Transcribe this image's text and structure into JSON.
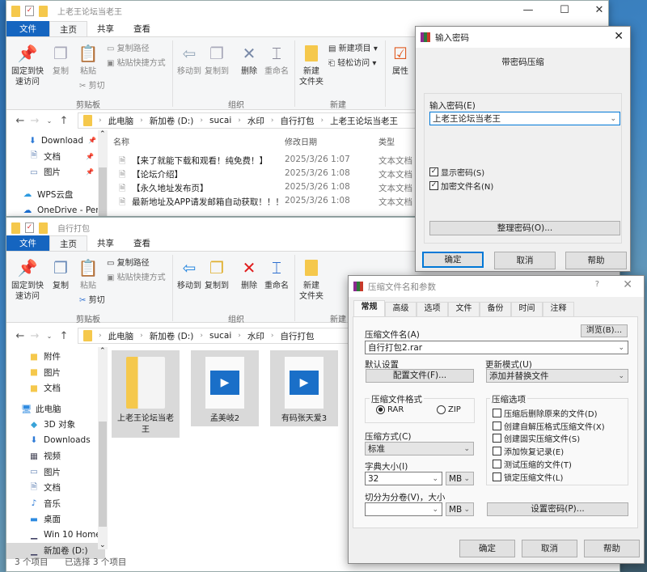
{
  "colors": {
    "accent": "#1565c0",
    "delete_red": "#e01c1c",
    "selection": "#d9d9d9"
  },
  "explorer1": {
    "title": "上老王论坛当老王",
    "window_controls": [
      "—",
      "☐",
      "✕"
    ],
    "tabs": [
      "文件",
      "主页",
      "共享",
      "查看"
    ],
    "ribbon": {
      "pin": "固定到快\n速访问",
      "copy": "复制",
      "paste": "粘贴",
      "copy_path": "复制路径",
      "paste_shortcut": "粘贴快捷方式",
      "cut": "剪切",
      "clipboard": "剪贴板",
      "move_to": "移动到",
      "copy_to": "复制到",
      "delete": "删除",
      "rename": "重命名",
      "organize": "组织",
      "new_folder": "新建\n文件夹",
      "new_item": "新建项目 ▾",
      "easy_access": "轻松访问 ▾",
      "new": "新建",
      "properties": "属性"
    },
    "breadcrumb": [
      "此电脑",
      "新加卷 (D:)",
      "sucai",
      "水印",
      "自行打包",
      "上老王论坛当老王"
    ],
    "sidebar": [
      {
        "label": "Download",
        "icon": "download-icon"
      },
      {
        "label": "文档",
        "icon": "document-icon"
      },
      {
        "label": "图片",
        "icon": "picture-icon"
      },
      {
        "label": "WPS云盘",
        "icon": "cloud-icon"
      },
      {
        "label": "OneDrive - Per",
        "icon": "onedrive-icon"
      }
    ],
    "columns": [
      "名称",
      "修改日期",
      "类型"
    ],
    "files": [
      {
        "name": "【来了就能下载和观看！纯免费！】",
        "date": "2025/3/26 1:07",
        "type": "文本文档"
      },
      {
        "name": "【论坛介绍】",
        "date": "2025/3/26 1:08",
        "type": "文本文档"
      },
      {
        "name": "【永久地址发布页】",
        "date": "2025/3/26 1:08",
        "type": "文本文档"
      },
      {
        "name": "最新地址及APP请发邮箱自动获取！！！",
        "date": "2025/3/26 1:08",
        "type": "文本文档"
      }
    ]
  },
  "explorer2": {
    "title": "自行打包",
    "tabs": [
      "文件",
      "主页",
      "共享",
      "查看"
    ],
    "ribbon": {
      "pin": "固定到快\n速访问",
      "copy": "复制",
      "paste": "粘贴",
      "copy_path": "复制路径",
      "paste_shortcut": "粘贴快捷方式",
      "cut": "剪切",
      "clipboard": "剪贴板",
      "move_to": "移动到",
      "copy_to": "复制到",
      "delete": "删除",
      "rename": "重命名",
      "organize": "组织",
      "new_folder": "新建\n文件夹",
      "new": "新建"
    },
    "breadcrumb": [
      "此电脑",
      "新加卷 (D:)",
      "sucai",
      "水印",
      "自行打包"
    ],
    "sidebar": [
      {
        "label": "附件",
        "icon": "folder-icon"
      },
      {
        "label": "图片",
        "icon": "folder-icon"
      },
      {
        "label": "文档",
        "icon": "folder-icon"
      },
      {
        "label": "此电脑",
        "icon": "computer-icon"
      },
      {
        "label": "3D 对象",
        "icon": "3d-objects-icon"
      },
      {
        "label": "Downloads",
        "icon": "download-icon"
      },
      {
        "label": "视频",
        "icon": "video-icon"
      },
      {
        "label": "图片",
        "icon": "picture-icon"
      },
      {
        "label": "文档",
        "icon": "document-icon"
      },
      {
        "label": "音乐",
        "icon": "music-icon"
      },
      {
        "label": "桌面",
        "icon": "desktop-icon"
      },
      {
        "label": "Win 10 Home",
        "icon": "network-drive-icon"
      },
      {
        "label": "新加卷 (D:)",
        "icon": "drive-icon"
      }
    ],
    "items": [
      {
        "name": "上老王论坛当老王",
        "kind": "folder"
      },
      {
        "name": "孟美岐2",
        "kind": "video"
      },
      {
        "name": "有码张天爱3",
        "kind": "video"
      }
    ],
    "status_count": "3 个项目",
    "status_selected": "已选择 3 个项目"
  },
  "password_dialog": {
    "title": "输入密码",
    "heading": "带密码压缩",
    "password_label": "输入密码(E)",
    "password_value": "上老王论坛当老王",
    "show_password": {
      "label": "显示密码(S)",
      "checked": true
    },
    "encrypt_names": {
      "label": "加密文件名(N)",
      "checked": true
    },
    "organize": "整理密码(O)...",
    "ok": "确定",
    "cancel": "取消",
    "help": "帮助"
  },
  "archive_dialog": {
    "title": "压缩文件名和参数",
    "help_glyph": "?",
    "tabs": [
      "常规",
      "高级",
      "选项",
      "文件",
      "备份",
      "时间",
      "注释"
    ],
    "archive_name_label": "压缩文件名(A)",
    "browse": "浏览(B)...",
    "archive_name": "自行打包2.rar",
    "default_settings": "默认设置",
    "profiles": "配置文件(F)...",
    "update_mode_label": "更新模式(U)",
    "update_mode": "添加并替换文件",
    "format_label": "压缩文件格式",
    "format_rar": "RAR",
    "format_zip": "ZIP",
    "format_selected": "RAR",
    "method_label": "压缩方式(C)",
    "method": "标准",
    "dict_label": "字典大小(I)",
    "dict_value": "32",
    "dict_unit": "MB",
    "split_label": "切分为分卷(V)，大小",
    "split_value": "",
    "split_unit": "MB",
    "options_label": "压缩选项",
    "options": [
      {
        "label": "压缩后删除原来的文件(D)",
        "checked": false
      },
      {
        "label": "创建自解压格式压缩文件(X)",
        "checked": false
      },
      {
        "label": "创建固实压缩文件(S)",
        "checked": false
      },
      {
        "label": "添加恢复记录(E)",
        "checked": false
      },
      {
        "label": "测试压缩的文件(T)",
        "checked": false
      },
      {
        "label": "锁定压缩文件(L)",
        "checked": false
      }
    ],
    "set_password": "设置密码(P)...",
    "ok": "确定",
    "cancel": "取消",
    "help": "帮助"
  }
}
